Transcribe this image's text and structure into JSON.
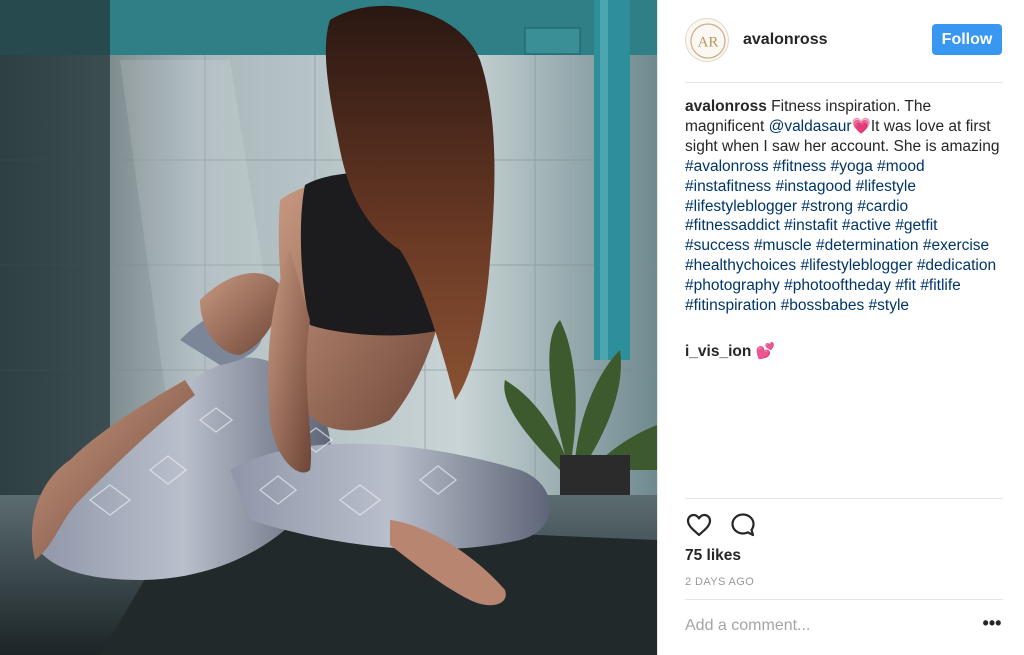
{
  "post": {
    "author": "avalonross",
    "avatar_monogram": "AR",
    "follow_label": "Follow",
    "caption": {
      "author": "avalonross",
      "text_before_mention": " Fitness inspiration. The magnificent ",
      "mention": "@valdasaur",
      "emoji1": "💗",
      "text_after_mention": "It was love at first sight when I saw her account. She is amazing ",
      "hashtags": [
        "#avalonross",
        "#fitness",
        "#yoga",
        "#mood",
        "#instafitness",
        "#instagood",
        "#lifestyle",
        "#lifestyleblogger",
        "#strong",
        "#cardio",
        "#fitnessaddict",
        "#instafit",
        "#active",
        "#getfit",
        "#success",
        "#muscle",
        "#determination",
        "#exercise",
        "#healthychoices",
        "#lifestyleblogger",
        "#dedication",
        "#photography",
        "#photooftheday",
        "#fit",
        "#fitlife",
        "#fitinspiration",
        "#bossbabes",
        "#style"
      ]
    },
    "comment": {
      "user": "i_vis_ion",
      "emoji": "💕"
    },
    "likes": "75 likes",
    "timestamp": "2 DAYS AGO",
    "add_comment_placeholder": "Add a comment...",
    "more_label": "•••",
    "icons": {
      "like": "heart-outline-icon",
      "comment": "speech-bubble-icon",
      "more": "ellipsis-icon"
    },
    "colors": {
      "follow_bg": "#3897f0",
      "link": "#003569",
      "muted": "#999999"
    }
  }
}
